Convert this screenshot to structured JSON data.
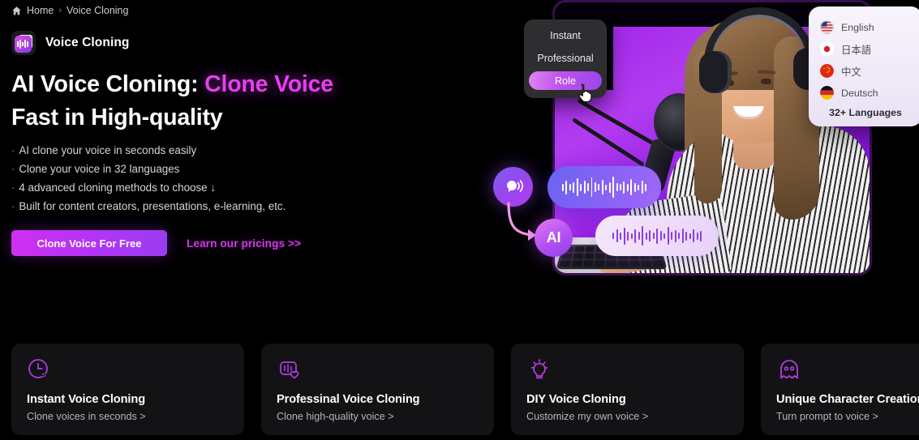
{
  "breadcrumb": {
    "home_icon": "home-icon",
    "home": "Home",
    "separator": "›",
    "current": "Voice Cloning"
  },
  "product": {
    "logo_icon": "voice-cloning-logo-icon",
    "title": "Voice Cloning"
  },
  "hero": {
    "heading_part1": "AI Voice Cloning: ",
    "heading_accent": "Clone Voice",
    "heading_part2": "Fast in High-quality",
    "accent_color": "#e63fef",
    "bullets": [
      "AI clone your voice in seconds easily",
      "Clone your voice in 32 languages",
      "4 advanced cloning methods to choose ↓",
      "Built for content creators, presentations, e-learning, etc."
    ],
    "bullet_marker": "·",
    "cta_primary": "Clone Voice For Free",
    "cta_link": "Learn our pricings >>",
    "cta_primary_color": "#b733f5",
    "cta_link_color": "#d33ae8"
  },
  "method_menu": {
    "items": [
      {
        "label": "Instant",
        "selected": false
      },
      {
        "label": "Professional",
        "selected": false
      },
      {
        "label": "Role",
        "selected": true
      }
    ],
    "cursor_icon": "pointer-hand-cursor-icon"
  },
  "language_panel": {
    "items": [
      {
        "label": "English",
        "flag": "flag-us-icon"
      },
      {
        "label": "日本語",
        "flag": "flag-jp-icon"
      },
      {
        "label": "中文",
        "flag": "flag-cn-icon"
      },
      {
        "label": "Deutsch",
        "flag": "flag-de-icon"
      }
    ],
    "more_label": "32+ Languages"
  },
  "hero_visual": {
    "voice_orb_icon": "speaking-head-icon",
    "ai_orb_label": "AI",
    "arrow_icon": "curved-arrow-icon",
    "waveform_top_icon": "waveform-icon",
    "waveform_bottom_icon": "waveform-icon",
    "person_icon": "woman-with-headphones-microphone-photo",
    "mic_icon": "studio-microphone-icon",
    "keyboard_icon": "keyboard-icon"
  },
  "cards": [
    {
      "icon": "clock-bolt-icon",
      "title": "Instant Voice Cloning",
      "subtitle": "Clone voices in seconds >"
    },
    {
      "icon": "waveform-heart-icon",
      "title": "Professinal Voice Cloning",
      "subtitle": "Clone high-quality voice >"
    },
    {
      "icon": "lightbulb-icon",
      "title": "DIY Voice Cloning",
      "subtitle": "Customize my own voice >"
    },
    {
      "icon": "ghost-icon",
      "title": "Unique Character Creation",
      "subtitle": "Turn prompt to voice >"
    }
  ]
}
